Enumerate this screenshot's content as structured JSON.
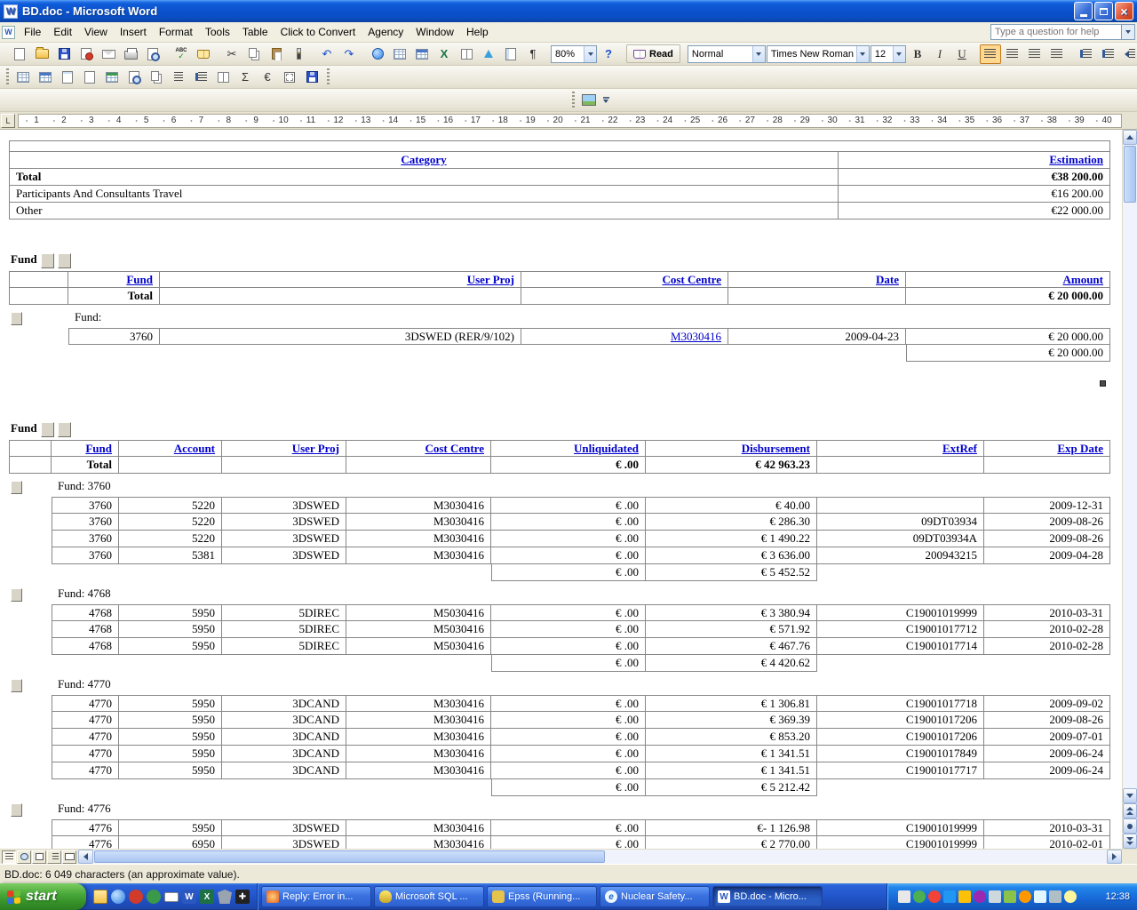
{
  "window": {
    "title": "BD.doc - Microsoft Word"
  },
  "menubar": {
    "items": [
      "File",
      "Edit",
      "View",
      "Insert",
      "Format",
      "Tools",
      "Table",
      "Click to Convert",
      "Agency",
      "Window",
      "Help"
    ],
    "question_placeholder": "Type a question for help"
  },
  "toolbars": {
    "zoom_value": "80%",
    "read_label": "Read",
    "style_value": "Normal",
    "font_value": "Times New Roman",
    "size_value": "12"
  },
  "ruler": {
    "numbers": [
      1,
      2,
      3,
      4,
      5,
      6,
      7,
      8,
      9,
      10,
      11,
      12,
      13,
      14,
      15,
      16,
      17,
      18,
      19,
      20,
      21,
      22,
      23,
      24,
      25,
      26,
      27,
      28,
      29,
      30,
      31,
      32,
      33,
      34,
      35,
      36,
      37,
      38,
      39,
      40
    ]
  },
  "document": {
    "summary_table": {
      "category_header": "Category",
      "estimation_header": "Estimation",
      "rows": [
        {
          "category": "Total",
          "estimation": "€38 200.00",
          "bold": true
        },
        {
          "category": "Participants And Consultants Travel",
          "estimation": "€16 200.00",
          "bold": false
        },
        {
          "category": "Other",
          "estimation": "€22 000.00",
          "bold": false
        }
      ]
    },
    "fund_table_1": {
      "section_title": "Fund",
      "headers": [
        "Fund",
        "User Proj",
        "Cost Centre",
        "Date",
        "Amount"
      ],
      "total_label": "Total",
      "total_amount": "€ 20 000.00",
      "group_label": "Fund:",
      "rows": [
        {
          "fund": "3760",
          "user_proj": "3DSWED (RER/9/102)",
          "cost_centre": "M3030416",
          "date": "2009-04-23",
          "amount": "€ 20 000.00"
        }
      ],
      "group_subtotal": "€ 20 000.00"
    },
    "fund_table_2": {
      "section_title": "Fund",
      "headers": [
        "Fund",
        "Account",
        "User Proj",
        "Cost Centre",
        "Unliquidated",
        "Disbursement",
        "ExtRef",
        "Exp Date"
      ],
      "total_label": "Total",
      "total_unliquidated": "€ .00",
      "total_disbursement": "€ 42 963.23",
      "groups": [
        {
          "label": "Fund: 3760",
          "rows": [
            {
              "fund": "3760",
              "account": "5220",
              "user_proj": "3DSWED",
              "cost_centre": "M3030416",
              "unliquidated": "€ .00",
              "disbursement": "€ 40.00",
              "extref": "",
              "exp_date": "2009-12-31"
            },
            {
              "fund": "3760",
              "account": "5220",
              "user_proj": "3DSWED",
              "cost_centre": "M3030416",
              "unliquidated": "€ .00",
              "disbursement": "€ 286.30",
              "extref": "09DT03934",
              "exp_date": "2009-08-26"
            },
            {
              "fund": "3760",
              "account": "5220",
              "user_proj": "3DSWED",
              "cost_centre": "M3030416",
              "unliquidated": "€ .00",
              "disbursement": "€ 1 490.22",
              "extref": "09DT03934A",
              "exp_date": "2009-08-26"
            },
            {
              "fund": "3760",
              "account": "5381",
              "user_proj": "3DSWED",
              "cost_centre": "M3030416",
              "unliquidated": "€ .00",
              "disbursement": "€ 3 636.00",
              "extref": "200943215",
              "exp_date": "2009-04-28"
            }
          ],
          "subtotal_unliquidated": "€ .00",
          "subtotal_disbursement": "€ 5 452.52"
        },
        {
          "label": "Fund: 4768",
          "rows": [
            {
              "fund": "4768",
              "account": "5950",
              "user_proj": "5DIREC",
              "cost_centre": "M5030416",
              "unliquidated": "€ .00",
              "disbursement": "€ 3 380.94",
              "extref": "C19001019999",
              "exp_date": "2010-03-31"
            },
            {
              "fund": "4768",
              "account": "5950",
              "user_proj": "5DIREC",
              "cost_centre": "M5030416",
              "unliquidated": "€ .00",
              "disbursement": "€ 571.92",
              "extref": "C19001017712",
              "exp_date": "2010-02-28"
            },
            {
              "fund": "4768",
              "account": "5950",
              "user_proj": "5DIREC",
              "cost_centre": "M5030416",
              "unliquidated": "€ .00",
              "disbursement": "€ 467.76",
              "extref": "C19001017714",
              "exp_date": "2010-02-28"
            }
          ],
          "subtotal_unliquidated": "€ .00",
          "subtotal_disbursement": "€ 4 420.62"
        },
        {
          "label": "Fund: 4770",
          "rows": [
            {
              "fund": "4770",
              "account": "5950",
              "user_proj": "3DCAND",
              "cost_centre": "M3030416",
              "unliquidated": "€ .00",
              "disbursement": "€ 1 306.81",
              "extref": "C19001017718",
              "exp_date": "2009-09-02"
            },
            {
              "fund": "4770",
              "account": "5950",
              "user_proj": "3DCAND",
              "cost_centre": "M3030416",
              "unliquidated": "€ .00",
              "disbursement": "€ 369.39",
              "extref": "C19001017206",
              "exp_date": "2009-08-26"
            },
            {
              "fund": "4770",
              "account": "5950",
              "user_proj": "3DCAND",
              "cost_centre": "M3030416",
              "unliquidated": "€ .00",
              "disbursement": "€ 853.20",
              "extref": "C19001017206",
              "exp_date": "2009-07-01"
            },
            {
              "fund": "4770",
              "account": "5950",
              "user_proj": "3DCAND",
              "cost_centre": "M3030416",
              "unliquidated": "€ .00",
              "disbursement": "€ 1 341.51",
              "extref": "C19001017849",
              "exp_date": "2009-06-24"
            },
            {
              "fund": "4770",
              "account": "5950",
              "user_proj": "3DCAND",
              "cost_centre": "M3030416",
              "unliquidated": "€ .00",
              "disbursement": "€ 1 341.51",
              "extref": "C19001017717",
              "exp_date": "2009-06-24"
            }
          ],
          "subtotal_unliquidated": "€ .00",
          "subtotal_disbursement": "€ 5 212.42"
        },
        {
          "label": "Fund: 4776",
          "rows": [
            {
              "fund": "4776",
              "account": "5950",
              "user_proj": "3DSWED",
              "cost_centre": "M3030416",
              "unliquidated": "€ .00",
              "disbursement": "€- 1 126.98",
              "extref": "C19001019999",
              "exp_date": "2010-03-31"
            },
            {
              "fund": "4776",
              "account": "6950",
              "user_proj": "3DSWED",
              "cost_centre": "M3030416",
              "unliquidated": "€ .00",
              "disbursement": "€ 2 770.00",
              "extref": "C19001019999",
              "exp_date": "2010-02-01"
            }
          ],
          "subtotal_unliquidated": "",
          "subtotal_disbursement": ""
        }
      ]
    }
  },
  "statusbar": {
    "text": "BD.doc: 6 049 characters (an approximate value)."
  },
  "taskbar": {
    "start_label": "start",
    "tasks": [
      {
        "label": "Reply: Error in...",
        "active": false
      },
      {
        "label": "Microsoft SQL ...",
        "active": false
      },
      {
        "label": "Epss (Running...",
        "active": false
      },
      {
        "label": "Nuclear Safety...",
        "active": false
      },
      {
        "label": "BD.doc - Micro...",
        "active": true
      }
    ],
    "clock": "12:38"
  },
  "colors": {
    "link_blue": "#0000cc",
    "titlebar_blue": "#0b51cc",
    "taskbar_blue": "#2256cc",
    "start_green": "#37922a",
    "toolbar_face": "#ece9d8",
    "selected_button_orange": "#ffd991"
  }
}
